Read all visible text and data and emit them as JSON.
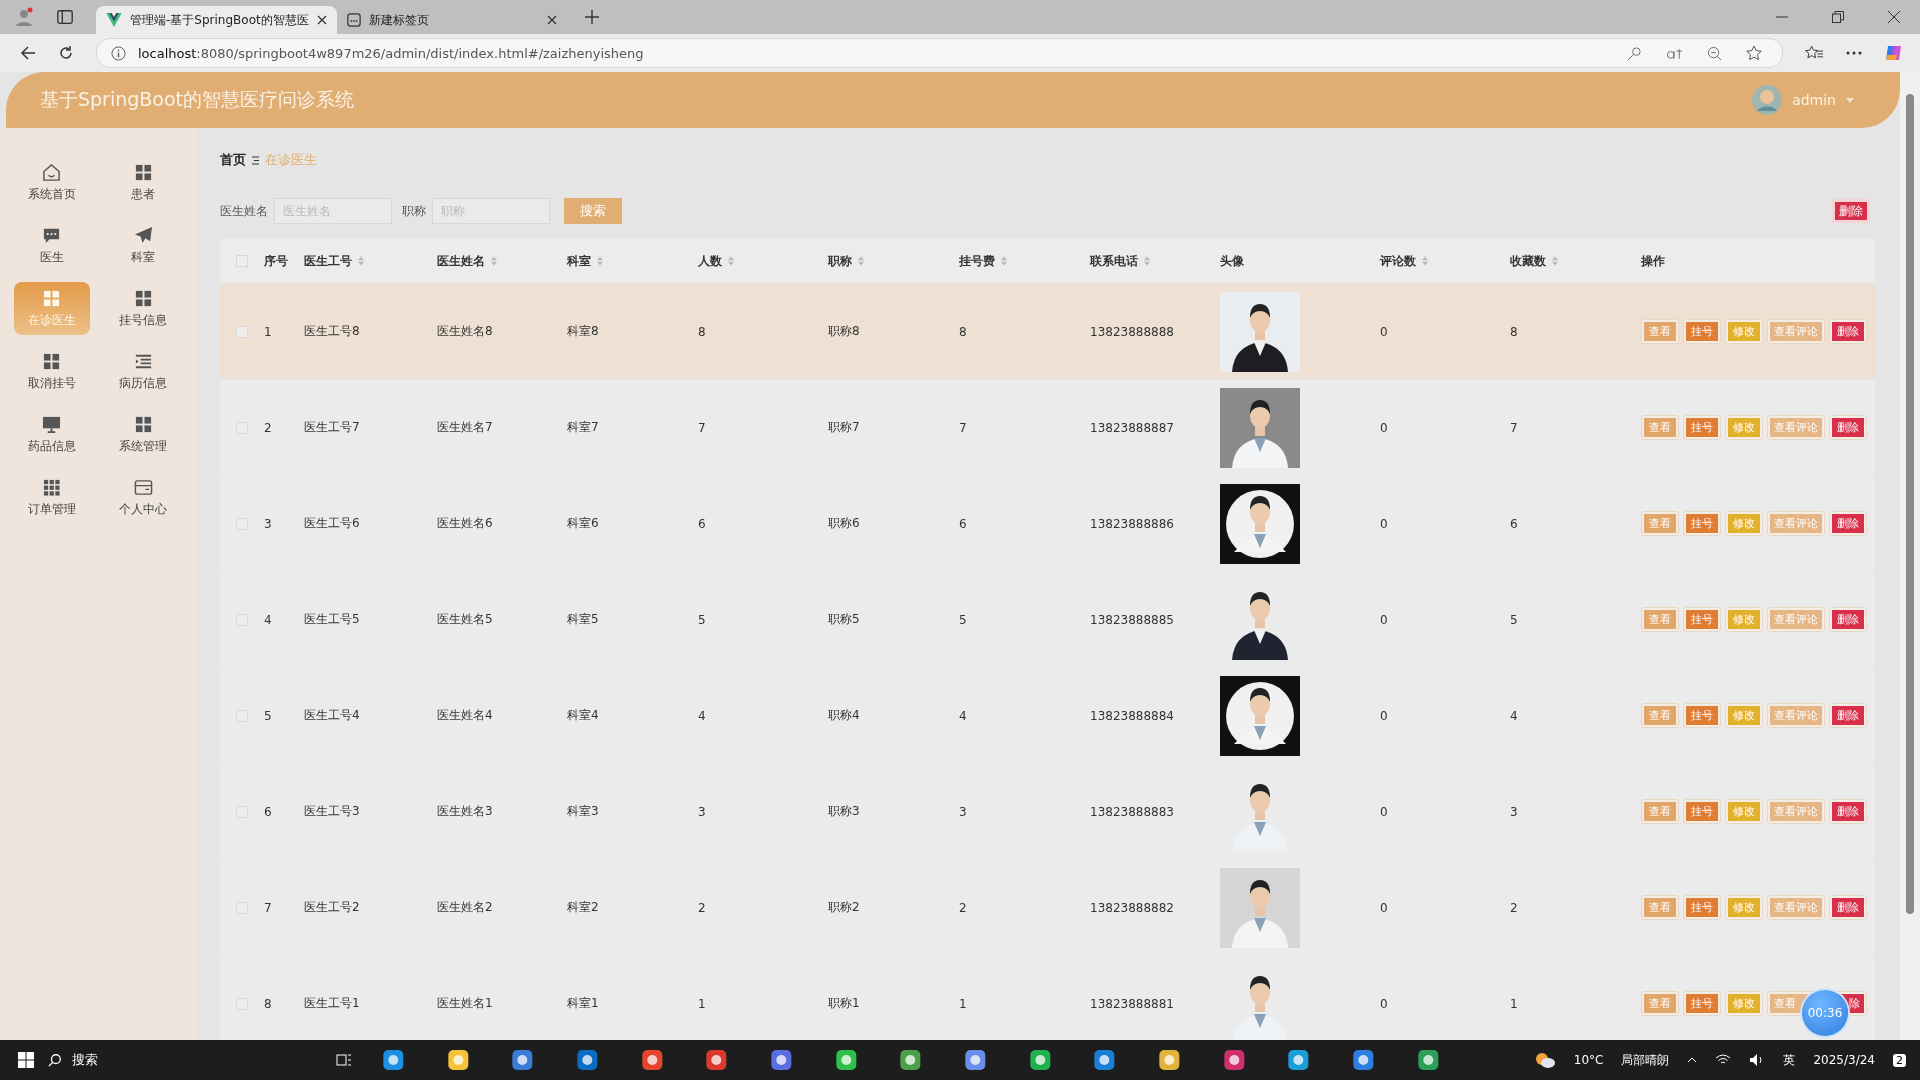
{
  "browser": {
    "tabs": [
      {
        "title": "管理端-基于SpringBoot的智慧医",
        "selected": true
      },
      {
        "title": "新建标签页",
        "selected": false
      }
    ],
    "url_host": "localhost",
    "url_rest": ":8080/springboot4w897m26/admin/dist/index.html#/zaizhenyisheng"
  },
  "header": {
    "title": "基于SpringBoot的智慧医疗问诊系统",
    "user": "admin"
  },
  "sidebar": {
    "items": [
      {
        "label": "系统首页",
        "selected": false
      },
      {
        "label": "患者",
        "selected": false
      },
      {
        "label": "医生",
        "selected": false
      },
      {
        "label": "科室",
        "selected": false
      },
      {
        "label": "在诊医生",
        "selected": true
      },
      {
        "label": "挂号信息",
        "selected": false
      },
      {
        "label": "取消挂号",
        "selected": false
      },
      {
        "label": "病历信息",
        "selected": false
      },
      {
        "label": "药品信息",
        "selected": false
      },
      {
        "label": "系统管理",
        "selected": false
      },
      {
        "label": "订单管理",
        "selected": false
      },
      {
        "label": "个人中心",
        "selected": false
      }
    ]
  },
  "breadcrumb": [
    "首页",
    "在诊医生"
  ],
  "search": {
    "fields": [
      {
        "label": "医生姓名",
        "placeholder": "医生姓名"
      },
      {
        "label": "职称",
        "placeholder": "职称"
      }
    ],
    "button": "搜索"
  },
  "bulk_delete": "删除",
  "table": {
    "header_checked": false,
    "columns": [
      {
        "label": "序号",
        "sortable": false
      },
      {
        "label": "医生工号",
        "sortable": true
      },
      {
        "label": "医生姓名",
        "sortable": true
      },
      {
        "label": "科室",
        "sortable": true
      },
      {
        "label": "人数",
        "sortable": true
      },
      {
        "label": "职称",
        "sortable": true
      },
      {
        "label": "挂号费",
        "sortable": true
      },
      {
        "label": "联系电话",
        "sortable": true
      },
      {
        "label": "头像",
        "sortable": false
      },
      {
        "label": "评论数",
        "sortable": true
      },
      {
        "label": "收藏数",
        "sortable": true
      },
      {
        "label": "操作",
        "sortable": false
      }
    ],
    "rows": [
      {
        "checked": false,
        "hovered": true,
        "no": "1",
        "doctor_id": "医生工号8",
        "doctor_name": "医生姓名8",
        "department": "科室8",
        "patients": "8",
        "title": "职称8",
        "fee": "8",
        "phone": "13823888888",
        "comments": "0",
        "favorites": "8",
        "actions": [
          {
            "label": "查看",
            "kind": "view"
          },
          {
            "label": "挂号",
            "kind": "register"
          },
          {
            "label": "修改",
            "kind": "edit"
          },
          {
            "label": "查看评论",
            "kind": "comments"
          },
          {
            "label": "删除",
            "kind": "delete"
          }
        ]
      },
      {
        "checked": false,
        "hovered": false,
        "no": "2",
        "doctor_id": "医生工号7",
        "doctor_name": "医生姓名7",
        "department": "科室7",
        "patients": "7",
        "title": "职称7",
        "fee": "7",
        "phone": "13823888887",
        "comments": "0",
        "favorites": "7",
        "actions": [
          {
            "label": "查看",
            "kind": "view"
          },
          {
            "label": "挂号",
            "kind": "register"
          },
          {
            "label": "修改",
            "kind": "edit"
          },
          {
            "label": "查看评论",
            "kind": "comments"
          },
          {
            "label": "删除",
            "kind": "delete"
          }
        ]
      },
      {
        "checked": false,
        "hovered": false,
        "no": "3",
        "doctor_id": "医生工号6",
        "doctor_name": "医生姓名6",
        "department": "科室6",
        "patients": "6",
        "title": "职称6",
        "fee": "6",
        "phone": "13823888886",
        "comments": "0",
        "favorites": "6",
        "actions": [
          {
            "label": "查看",
            "kind": "view"
          },
          {
            "label": "挂号",
            "kind": "register"
          },
          {
            "label": "修改",
            "kind": "edit"
          },
          {
            "label": "查看评论",
            "kind": "comments"
          },
          {
            "label": "删除",
            "kind": "delete"
          }
        ]
      },
      {
        "checked": false,
        "hovered": false,
        "no": "4",
        "doctor_id": "医生工号5",
        "doctor_name": "医生姓名5",
        "department": "科室5",
        "patients": "5",
        "title": "职称5",
        "fee": "5",
        "phone": "13823888885",
        "comments": "0",
        "favorites": "5",
        "actions": [
          {
            "label": "查看",
            "kind": "view"
          },
          {
            "label": "挂号",
            "kind": "register"
          },
          {
            "label": "修改",
            "kind": "edit"
          },
          {
            "label": "查看评论",
            "kind": "comments"
          },
          {
            "label": "删除",
            "kind": "delete"
          }
        ]
      },
      {
        "checked": false,
        "hovered": false,
        "no": "5",
        "doctor_id": "医生工号4",
        "doctor_name": "医生姓名4",
        "department": "科室4",
        "patients": "4",
        "title": "职称4",
        "fee": "4",
        "phone": "13823888884",
        "comments": "0",
        "favorites": "4",
        "actions": [
          {
            "label": "查看",
            "kind": "view"
          },
          {
            "label": "挂号",
            "kind": "register"
          },
          {
            "label": "修改",
            "kind": "edit"
          },
          {
            "label": "查看评论",
            "kind": "comments"
          },
          {
            "label": "删除",
            "kind": "delete"
          }
        ]
      },
      {
        "checked": false,
        "hovered": false,
        "no": "6",
        "doctor_id": "医生工号3",
        "doctor_name": "医生姓名3",
        "department": "科室3",
        "patients": "3",
        "title": "职称3",
        "fee": "3",
        "phone": "13823888883",
        "comments": "0",
        "favorites": "3",
        "actions": [
          {
            "label": "查看",
            "kind": "view"
          },
          {
            "label": "挂号",
            "kind": "register"
          },
          {
            "label": "修改",
            "kind": "edit"
          },
          {
            "label": "查看评论",
            "kind": "comments"
          },
          {
            "label": "删除",
            "kind": "delete"
          }
        ]
      },
      {
        "checked": false,
        "hovered": false,
        "no": "7",
        "doctor_id": "医生工号2",
        "doctor_name": "医生姓名2",
        "department": "科室2",
        "patients": "2",
        "title": "职称2",
        "fee": "2",
        "phone": "13823888882",
        "comments": "0",
        "favorites": "2",
        "actions": [
          {
            "label": "查看",
            "kind": "view"
          },
          {
            "label": "挂号",
            "kind": "register"
          },
          {
            "label": "修改",
            "kind": "edit"
          },
          {
            "label": "查看评论",
            "kind": "comments"
          },
          {
            "label": "删除",
            "kind": "delete"
          }
        ]
      },
      {
        "checked": false,
        "hovered": false,
        "no": "8",
        "doctor_id": "医生工号1",
        "doctor_name": "医生姓名1",
        "department": "科室1",
        "patients": "1",
        "title": "职称1",
        "fee": "1",
        "phone": "13823888881",
        "comments": "0",
        "favorites": "1",
        "actions": [
          {
            "label": "查看",
            "kind": "view"
          },
          {
            "label": "挂号",
            "kind": "register"
          },
          {
            "label": "修改",
            "kind": "edit"
          },
          {
            "label": "查看",
            "kind": "comments"
          },
          {
            "label": "除",
            "kind": "delete"
          }
        ]
      }
    ]
  },
  "recorder_timer": "00:36",
  "taskbar": {
    "search": "搜索",
    "temperature": "10°C",
    "weather": "局部晴朗",
    "ime": "英",
    "date": "2025/3/24",
    "notifications": "2"
  }
}
